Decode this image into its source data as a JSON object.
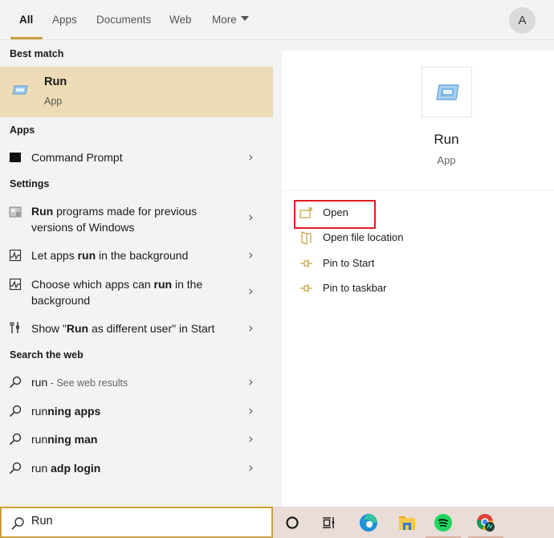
{
  "tabs": [
    {
      "label": "All",
      "active": true
    },
    {
      "label": "Apps"
    },
    {
      "label": "Documents"
    },
    {
      "label": "Web"
    },
    {
      "label": "More"
    }
  ],
  "avatar": {
    "initial": "A"
  },
  "left": {
    "best_match": {
      "heading": "Best match",
      "title": "Run",
      "subtitle": "App",
      "icon": "run-app-icon"
    },
    "apps": {
      "heading": "Apps",
      "items": [
        {
          "label": "Command Prompt",
          "icon": "command-prompt-icon"
        }
      ]
    },
    "settings": {
      "heading": "Settings",
      "items": [
        {
          "bold": "Run",
          "pre": "",
          "post": " programs made for previous versions of Windows",
          "icon": "compatibility-icon"
        },
        {
          "pre": "Let apps ",
          "bold": "run",
          "post": " in the background",
          "icon": "background-apps-icon"
        },
        {
          "pre": "Choose which apps can ",
          "bold": "run",
          "post": " in the background",
          "icon": "background-apps-icon"
        },
        {
          "pre": "Show \"",
          "bold": "Run",
          "post": " as different user\" in Start",
          "icon": "start-settings-icon"
        }
      ]
    },
    "web": {
      "heading": "Search the web",
      "items": [
        {
          "pre": "run",
          "bold": "",
          "post": "",
          "muted": " - See web results"
        },
        {
          "pre": "run",
          "bold": "ning apps",
          "post": ""
        },
        {
          "pre": "run",
          "bold": "ning man",
          "post": ""
        },
        {
          "pre": "run ",
          "bold": "adp login",
          "post": ""
        }
      ]
    }
  },
  "search": {
    "value": "Run",
    "icon": "search-icon"
  },
  "detail": {
    "app_name": "Run",
    "app_type": "App",
    "actions": [
      {
        "label": "Open",
        "icon": "open-icon",
        "highlighted": true
      },
      {
        "label": "Open file location",
        "icon": "folder-location-icon"
      },
      {
        "label": "Pin to Start",
        "icon": "pin-icon"
      },
      {
        "label": "Pin to taskbar",
        "icon": "pin-icon"
      }
    ]
  },
  "taskbar": {
    "items": [
      {
        "name": "cortana-icon"
      },
      {
        "name": "task-view-icon"
      },
      {
        "name": "edge-icon"
      },
      {
        "name": "file-explorer-icon"
      },
      {
        "name": "spotify-icon"
      },
      {
        "name": "chrome-icon"
      }
    ]
  },
  "colors": {
    "accent": "#c9a13b",
    "best_match_bg": "#ecdbb5",
    "highlight_border": "#e01b24",
    "taskbar_bg": "#eadcd7"
  }
}
